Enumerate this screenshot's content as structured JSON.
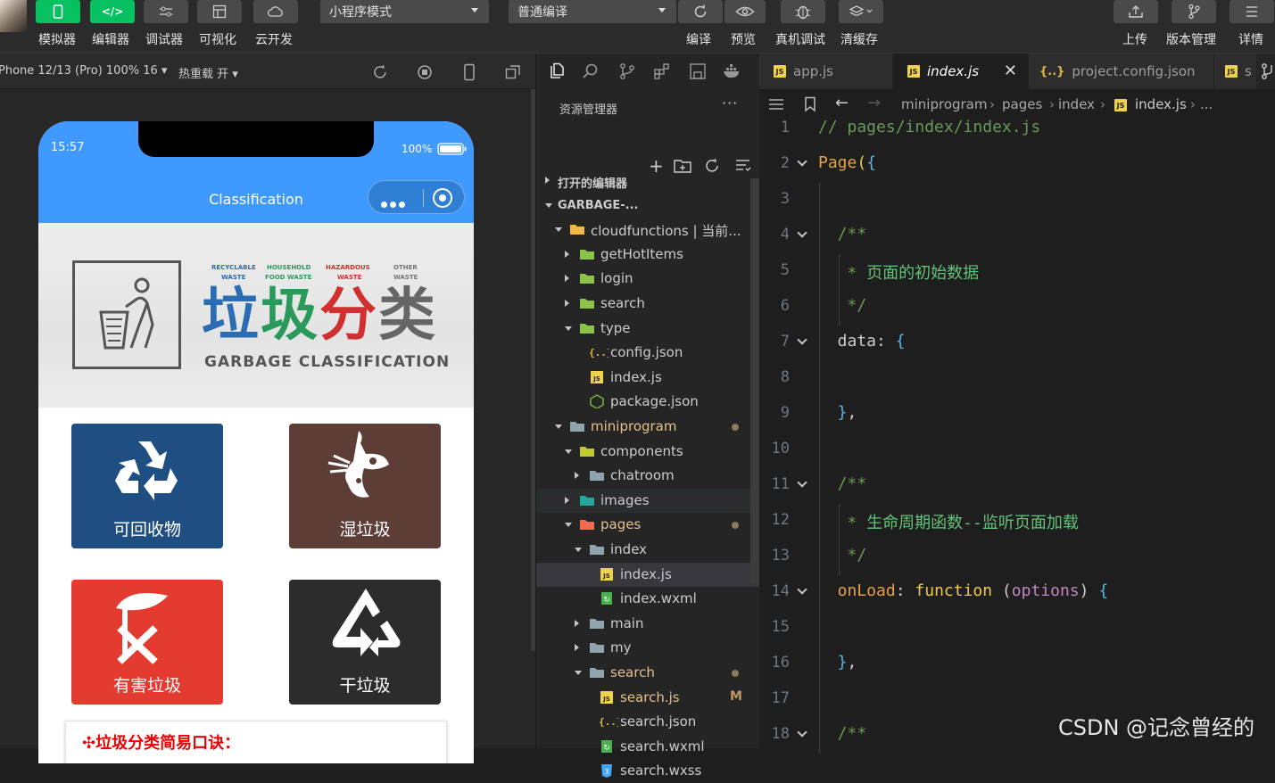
{
  "toolbar": {
    "simulator": "模拟器",
    "editor": "编辑器",
    "debugger": "调试器",
    "visual": "可视化",
    "cloud": "云开发",
    "mode_select": "小程序模式",
    "compile_select": "普通编译",
    "compile": "编译",
    "preview": "预览",
    "device_debug": "真机调试",
    "clear_cache": "清缓存",
    "upload": "上传",
    "version": "版本管理",
    "details": "详情"
  },
  "simbar": {
    "device": "Phone 12/13 (Pro) 100% 16",
    "hot_reload": "热重载 开"
  },
  "phone": {
    "time": "15:57",
    "battery": "100%",
    "title": "Classification",
    "banner": {
      "tags": [
        "RECYCLABLE",
        "HOUSEHOLD",
        "HAZARDOUS",
        "OTHER"
      ],
      "tags2": [
        "WASTE",
        "FOOD WASTE",
        "WASTE",
        "WASTE"
      ],
      "title_chars": [
        "垃",
        "圾",
        "分",
        "类"
      ],
      "subtitle": "GARBAGE CLASSIFICATION"
    },
    "categories": [
      {
        "label": "可回收物",
        "color": "#1f4f82"
      },
      {
        "label": "湿垃圾",
        "color": "#5d3e36"
      },
      {
        "label": "有害垃圾",
        "color": "#e53a2f"
      },
      {
        "label": "干垃圾",
        "color": "#2c2c2c"
      }
    ],
    "tip": "✣垃圾分类简易口诀："
  },
  "explorer": {
    "title": "资源管理器",
    "more": "···",
    "rows": [
      {
        "label": "打开的编辑器",
        "depth": 0,
        "twist": "r",
        "icon": "none",
        "bold": true
      },
      {
        "label": "GARBAGE-...",
        "depth": 0,
        "twist": "d",
        "icon": "none",
        "bold": true
      },
      {
        "label": "cloudfunctions | 当前...",
        "depth": 1,
        "twist": "d",
        "icon": "folder-cloud"
      },
      {
        "label": "getHotItems",
        "depth": 2,
        "twist": "r",
        "icon": "folder-green"
      },
      {
        "label": "login",
        "depth": 2,
        "twist": "r",
        "icon": "folder-green"
      },
      {
        "label": "search",
        "depth": 2,
        "twist": "r",
        "icon": "folder-green"
      },
      {
        "label": "type",
        "depth": 2,
        "twist": "d",
        "icon": "folder-green"
      },
      {
        "label": "config.json",
        "depth": 3,
        "twist": "",
        "icon": "json"
      },
      {
        "label": "index.js",
        "depth": 3,
        "twist": "",
        "icon": "js"
      },
      {
        "label": "package.json",
        "depth": 3,
        "twist": "",
        "icon": "node"
      },
      {
        "label": "miniprogram",
        "depth": 1,
        "twist": "d",
        "icon": "folder",
        "mod": true,
        "dot": true
      },
      {
        "label": "components",
        "depth": 2,
        "twist": "d",
        "icon": "folder-comp"
      },
      {
        "label": "chatroom",
        "depth": 3,
        "twist": "r",
        "icon": "folder"
      },
      {
        "label": "images",
        "depth": 2,
        "twist": "r",
        "icon": "folder-img",
        "hover": true
      },
      {
        "label": "pages",
        "depth": 2,
        "twist": "d",
        "icon": "folder-pages",
        "mod": true,
        "dot": true
      },
      {
        "label": "index",
        "depth": 3,
        "twist": "d",
        "icon": "folder"
      },
      {
        "label": "index.js",
        "depth": 4,
        "twist": "",
        "icon": "js",
        "selected": true
      },
      {
        "label": "index.wxml",
        "depth": 4,
        "twist": "",
        "icon": "wxml"
      },
      {
        "label": "main",
        "depth": 3,
        "twist": "r",
        "icon": "folder"
      },
      {
        "label": "my",
        "depth": 3,
        "twist": "r",
        "icon": "folder"
      },
      {
        "label": "search",
        "depth": 3,
        "twist": "d",
        "icon": "folder",
        "mod": true,
        "dot": true
      },
      {
        "label": "search.js",
        "depth": 4,
        "twist": "",
        "icon": "js",
        "mod": true,
        "m": "M"
      },
      {
        "label": "search.json",
        "depth": 4,
        "twist": "",
        "icon": "json"
      },
      {
        "label": "search.wxml",
        "depth": 4,
        "twist": "",
        "icon": "wxml"
      },
      {
        "label": "search.wxss",
        "depth": 4,
        "twist": "",
        "icon": "wxss"
      }
    ]
  },
  "editor": {
    "tabs": [
      {
        "label": "app.js",
        "icon": "js"
      },
      {
        "label": "index.js",
        "icon": "js",
        "active": true
      },
      {
        "label": "project.config.json",
        "icon": "json"
      },
      {
        "label": "s",
        "icon": "js"
      }
    ],
    "breadcrumb": [
      "miniprogram",
      "pages",
      "index",
      "index.js",
      "..."
    ],
    "lines": [
      {
        "n": "1",
        "segs": [
          [
            "// pages/index/index.js",
            "c-com"
          ]
        ]
      },
      {
        "n": "2",
        "fold": true,
        "segs": [
          [
            "Page",
            "c-fn"
          ],
          [
            "(",
            "c-br"
          ],
          [
            "{",
            "c-br2"
          ]
        ]
      },
      {
        "n": "3",
        "segs": []
      },
      {
        "n": "4",
        "fold": true,
        "segs": [
          [
            "  /**",
            "c-com"
          ]
        ]
      },
      {
        "n": "5",
        "segs": [
          [
            "   * ",
            "c-com"
          ],
          [
            "页面的初始数据",
            "c-cn"
          ]
        ]
      },
      {
        "n": "6",
        "segs": [
          [
            "   */",
            "c-com"
          ]
        ]
      },
      {
        "n": "7",
        "fold": true,
        "segs": [
          [
            "  data",
            "c-pn"
          ],
          [
            ": ",
            "c-pn"
          ],
          [
            "{",
            "c-br2"
          ]
        ]
      },
      {
        "n": "8",
        "segs": []
      },
      {
        "n": "9",
        "segs": [
          [
            "  }",
            "c-br2"
          ],
          [
            ",",
            "c-pn"
          ]
        ]
      },
      {
        "n": "10",
        "segs": []
      },
      {
        "n": "11",
        "fold": true,
        "segs": [
          [
            "  /**",
            "c-com"
          ]
        ]
      },
      {
        "n": "12",
        "segs": [
          [
            "   * ",
            "c-com"
          ],
          [
            "生命周期函数--监听页面加载",
            "c-cn"
          ]
        ]
      },
      {
        "n": "13",
        "segs": [
          [
            "   */",
            "c-com"
          ]
        ]
      },
      {
        "n": "14",
        "fold": true,
        "segs": [
          [
            "  onLoad",
            "c-prop"
          ],
          [
            ": ",
            "c-pn"
          ],
          [
            "function",
            "c-kw"
          ],
          [
            " (",
            "c-pn"
          ],
          [
            "options",
            "c-par"
          ],
          [
            ") ",
            "c-pn"
          ],
          [
            "{",
            "c-br2"
          ]
        ]
      },
      {
        "n": "15",
        "segs": []
      },
      {
        "n": "16",
        "segs": [
          [
            "  }",
            "c-br2"
          ],
          [
            ",",
            "c-pn"
          ]
        ]
      },
      {
        "n": "17",
        "segs": []
      },
      {
        "n": "18",
        "fold": true,
        "segs": [
          [
            "  /**",
            "c-com"
          ]
        ]
      }
    ]
  },
  "watermark": "CSDN @记念曾经的"
}
